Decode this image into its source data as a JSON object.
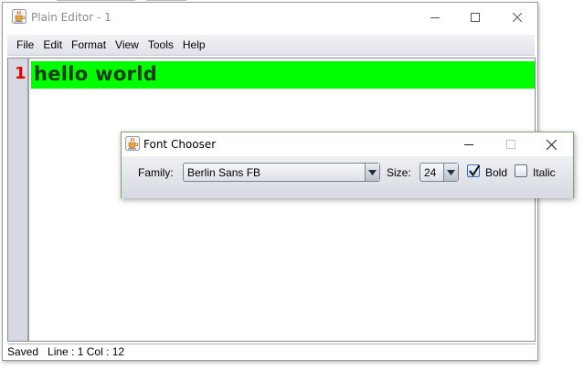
{
  "editor": {
    "title": "Plain Editor - 1",
    "menu": [
      "File",
      "Edit",
      "Format",
      "View",
      "Tools",
      "Help"
    ],
    "line_number": "1",
    "content": "hello world",
    "highlight_color": "#00ff00",
    "status": "Saved   Line : 1 Col : 12"
  },
  "dialog": {
    "title": "Font Chooser",
    "family_label": "Family:",
    "family_value": "Berlin Sans FB",
    "size_label": "Size:",
    "size_value": "24",
    "bold_label": "Bold",
    "bold_checked": true,
    "italic_label": "Italic",
    "italic_checked": false,
    "border_color": "#7fa56a"
  },
  "icons": {
    "app": "java-coffee-cup-icon",
    "minimize": "minimize-icon",
    "maximize": "maximize-icon",
    "close": "close-icon",
    "dropdown": "chevron-down-icon",
    "check": "checkmark-icon"
  }
}
